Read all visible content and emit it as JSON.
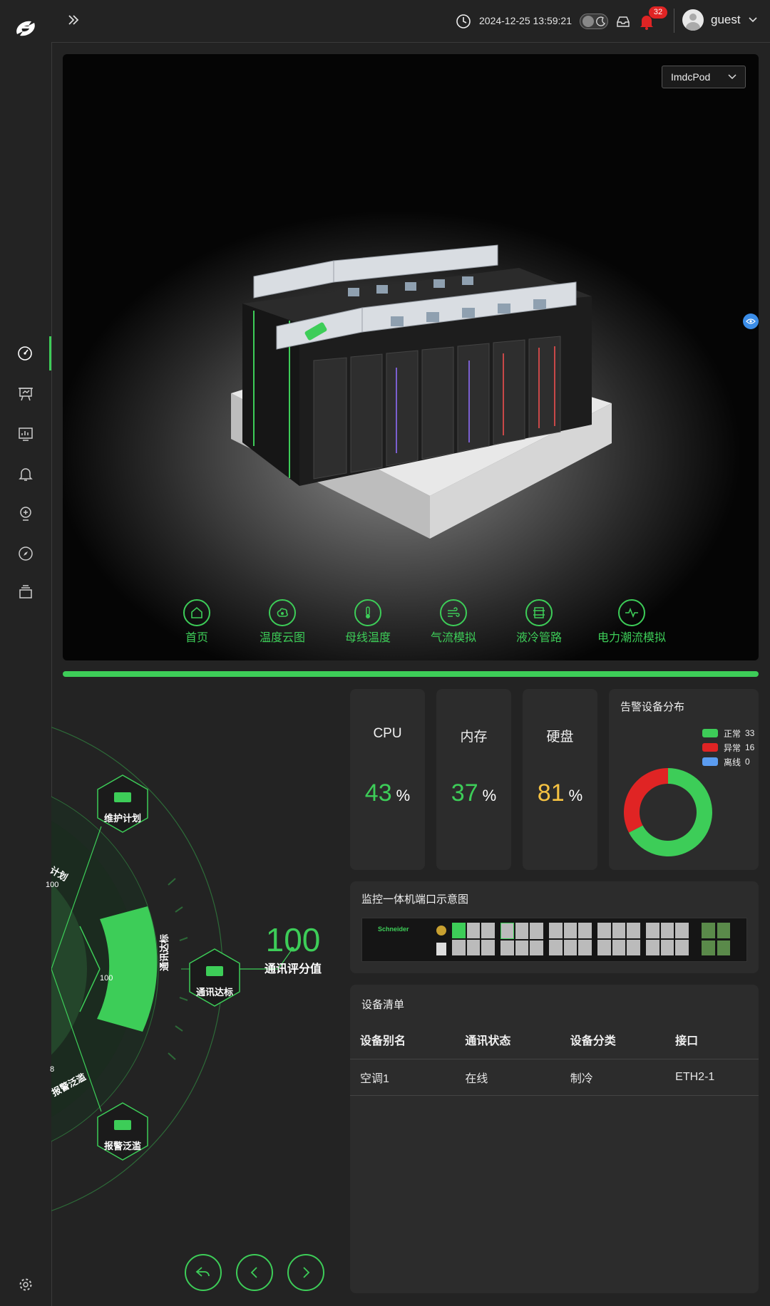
{
  "topbar": {
    "datetime": "2024-12-25 13:59:21",
    "notification_count": "32",
    "username": "guest"
  },
  "scene": {
    "selected_pod": "ImdcPod",
    "tools": [
      {
        "label": "首页",
        "icon": "home-icon"
      },
      {
        "label": "温度云图",
        "icon": "temperature-cloud-icon"
      },
      {
        "label": "母线温度",
        "icon": "thermometer-icon"
      },
      {
        "label": "气流模拟",
        "icon": "airflow-icon"
      },
      {
        "label": "液冷管路",
        "icon": "liquid-cooling-icon"
      },
      {
        "label": "电力潮流模拟",
        "icon": "power-flow-icon"
      }
    ]
  },
  "metrics": {
    "cpu": {
      "label": "CPU",
      "value": "43",
      "unit": "%",
      "color": "#3dcd58"
    },
    "memory": {
      "label": "内存",
      "value": "37",
      "unit": "%",
      "color": "#3dcd58"
    },
    "disk": {
      "label": "硬盘",
      "value": "81",
      "unit": "%",
      "color": "#f5c242"
    }
  },
  "alarm_distribution": {
    "title": "告警设备分布",
    "items": [
      {
        "label": "正常",
        "value": 33,
        "display": "33",
        "color": "#3dcd58"
      },
      {
        "label": "异常",
        "value": 16,
        "display": "16",
        "color": "#e02424"
      },
      {
        "label": "离线",
        "value": 0,
        "display": "0",
        "color": "#5b9cf0"
      }
    ]
  },
  "port_diagram": {
    "title": "监控一体机端口示意图",
    "brand": "Schneider"
  },
  "device_list": {
    "title": "设备清单",
    "columns": [
      "设备别名",
      "通讯状态",
      "设备分类",
      "接口"
    ],
    "rows": [
      [
        "空调1",
        "在线",
        "制冷",
        "ETH2-1"
      ]
    ]
  },
  "score_wheel": {
    "score": "100",
    "score_label": "通讯评分值",
    "segment_value": "100",
    "segment_label": "通讯达标",
    "hexes": [
      "维护计划",
      "通讯达标",
      "报警泛滥"
    ],
    "partial_labels": [
      "计划",
      "100",
      "报警泛滥",
      "8"
    ]
  },
  "colors": {
    "accent": "#3dcd58",
    "warning": "#f5c242",
    "danger": "#e02424"
  }
}
